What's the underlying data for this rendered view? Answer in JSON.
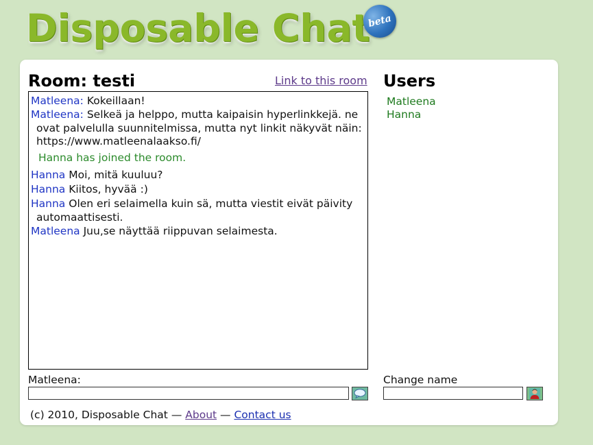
{
  "header": {
    "logo_text": "Disposable Chat",
    "beta_badge": "beta"
  },
  "room": {
    "title": "Room: testi",
    "link_label": "Link to this room"
  },
  "messages": [
    {
      "nick": "Matleena:",
      "text": "Kokeillaan!"
    },
    {
      "nick": "Matleena:",
      "text": "Selkeä ja helppo, mutta kaipaisin hyperlinkkejä. ne ovat palvelulla suunnitelmissa, mutta nyt linkit näkyvät näin: https://www.matleenalaakso.fi/"
    },
    {
      "system": "Hanna has joined the room."
    },
    {
      "nick": "Hanna",
      "text": "Moi, mitä kuuluu?"
    },
    {
      "nick": "Hanna",
      "text": "Kiitos, hyvää :)"
    },
    {
      "nick": "Hanna",
      "text": "Olen eri selaimella kuin sä, mutta viestit eivät päivity automaattisesti."
    },
    {
      "nick": "Matleena",
      "text": "Juu,se näyttää riippuvan selaimesta."
    }
  ],
  "users": {
    "title": "Users",
    "list": [
      "Matleena",
      "Hanna"
    ]
  },
  "message_input": {
    "label": "Matleena:",
    "value": "",
    "send_icon": "speech-bubble-icon"
  },
  "name_input": {
    "label": "Change name",
    "value": "",
    "button_icon": "user-icon"
  },
  "footer": {
    "copyright": "(c) 2010, Disposable Chat —",
    "about": "About",
    "separator": "—",
    "contact": "Contact us"
  },
  "colors": {
    "background": "#d1e5c3",
    "logo_green": "#8ab82a",
    "nick_blue": "#1f35c4",
    "system_green": "#2b8a2b",
    "user_green": "#1e7a1e"
  }
}
